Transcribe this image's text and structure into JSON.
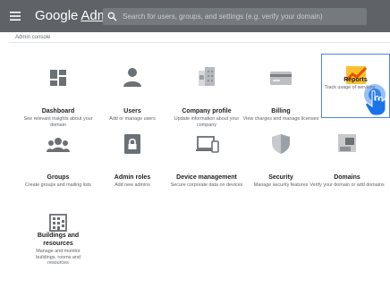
{
  "topbar": {
    "brand_google": "Google",
    "brand_admin": "Admin",
    "search_placeholder": "Search for users, groups, and settings (e.g. verify your domain)"
  },
  "breadcrumb": "Admin console",
  "cards": {
    "dashboard": {
      "title": "Dashboard",
      "desc": "See relevant insights about your domain",
      "icon": "dashboard-icon"
    },
    "users": {
      "title": "Users",
      "desc": "Add or manage users",
      "icon": "person-icon"
    },
    "company": {
      "title": "Company profile",
      "desc": "Update information about your company",
      "icon": "company-building-icon"
    },
    "billing": {
      "title": "Billing",
      "desc": "View charges and manage licenses",
      "icon": "credit-card-icon"
    },
    "reports": {
      "title": "Reports",
      "desc": "Track usage of services",
      "icon": "line-chart-icon"
    },
    "groups": {
      "title": "Groups",
      "desc": "Create groups and mailing lists",
      "icon": "group-icon"
    },
    "roles": {
      "title": "Admin roles",
      "desc": "Add new admins",
      "icon": "lock-icon"
    },
    "devices": {
      "title": "Device management",
      "desc": "Secure corporate data on devices",
      "icon": "devices-icon"
    },
    "security": {
      "title": "Security",
      "desc": "Manage security features",
      "icon": "shield-icon"
    },
    "domains": {
      "title": "Domains",
      "desc": "Verify your domain or add domains",
      "icon": "domain-icon"
    },
    "buildings": {
      "title": "Buildings and resources",
      "desc": "Manage and monitor buildings, rooms and resources",
      "icon": "building-icon"
    }
  },
  "colors": {
    "topbar": "#5f6368",
    "accent_blue": "#4a86e8",
    "cursor_blue": "#1a73e8",
    "reports_orange": "#f57c00",
    "reports_yellow": "#fbc02d"
  }
}
